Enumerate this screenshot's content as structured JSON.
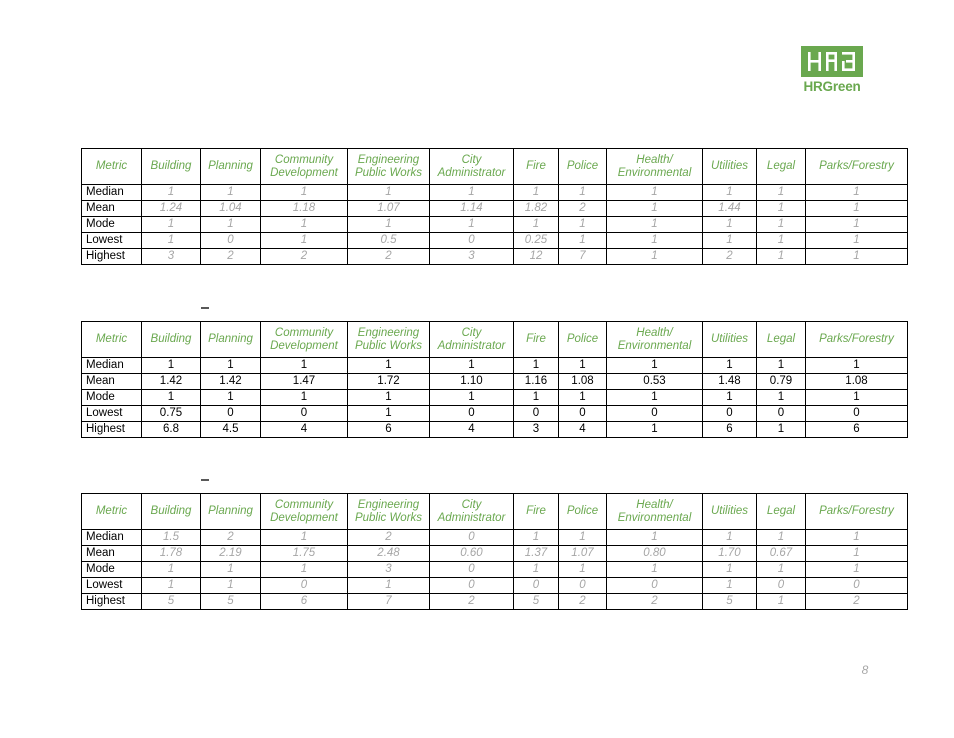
{
  "logo": {
    "mark_text": "HRG",
    "wordmark": "HRGreen",
    "brand_color": "#6aa84f"
  },
  "page": {
    "number": "8",
    "number_color": "#a6a6a6"
  },
  "marks": {
    "dash_1": "-",
    "dash_2": "-"
  },
  "columns": [
    "Metric",
    "Building",
    "Planning",
    "Community Development",
    "Engineering Public Works",
    "City Administrator",
    "Fire",
    "Police",
    "Health/ Environmental",
    "Utilities",
    "Legal",
    "Parks/Forestry"
  ],
  "column_lines": [
    [
      "Metric",
      ""
    ],
    [
      "Building",
      ""
    ],
    [
      "Planning",
      ""
    ],
    [
      "Community",
      "Development"
    ],
    [
      "Engineering",
      "Public Works"
    ],
    [
      "City",
      "Administrator"
    ],
    [
      "Fire",
      ""
    ],
    [
      "Police",
      ""
    ],
    [
      "Health/",
      "Environmental"
    ],
    [
      "Utilities",
      ""
    ],
    [
      "Legal",
      ""
    ],
    [
      "Parks/Forestry",
      ""
    ]
  ],
  "row_labels": [
    "Median",
    "Mean",
    "Mode",
    "Lowest",
    "Highest"
  ],
  "tables": [
    {
      "id": "table1",
      "value_style": "muted",
      "rows": [
        {
          "label": "Median",
          "values": [
            "1",
            "1",
            "1",
            "1",
            "1",
            "1",
            "1",
            "1",
            "1",
            "1",
            "1"
          ]
        },
        {
          "label": "Mean",
          "values": [
            "1.24",
            "1.04",
            "1.18",
            "1.07",
            "1.14",
            "1.82",
            "2",
            "1",
            "1.44",
            "1",
            "1"
          ]
        },
        {
          "label": "Mode",
          "values": [
            "1",
            "1",
            "1",
            "1",
            "1",
            "1",
            "1",
            "1",
            "1",
            "1",
            "1"
          ]
        },
        {
          "label": "Lowest",
          "values": [
            "1",
            "0",
            "1",
            "0.5",
            "0",
            "0.25",
            "1",
            "1",
            "1",
            "1",
            "1"
          ]
        },
        {
          "label": "Highest",
          "values": [
            "3",
            "2",
            "2",
            "2",
            "3",
            "12",
            "7",
            "1",
            "2",
            "1",
            "1"
          ]
        }
      ]
    },
    {
      "id": "table2",
      "value_style": "solid",
      "rows": [
        {
          "label": "Median",
          "values": [
            "1",
            "1",
            "1",
            "1",
            "1",
            "1",
            "1",
            "1",
            "1",
            "1",
            "1"
          ]
        },
        {
          "label": "Mean",
          "values": [
            "1.42",
            "1.42",
            "1.47",
            "1.72",
            "1.10",
            "1.16",
            "1.08",
            "0.53",
            "1.48",
            "0.79",
            "1.08"
          ]
        },
        {
          "label": "Mode",
          "values": [
            "1",
            "1",
            "1",
            "1",
            "1",
            "1",
            "1",
            "1",
            "1",
            "1",
            "1"
          ]
        },
        {
          "label": "Lowest",
          "values": [
            "0.75",
            "0",
            "0",
            "1",
            "0",
            "0",
            "0",
            "0",
            "0",
            "0",
            "0"
          ]
        },
        {
          "label": "Highest",
          "values": [
            "6.8",
            "4.5",
            "4",
            "6",
            "4",
            "3",
            "4",
            "1",
            "6",
            "1",
            "6"
          ]
        }
      ]
    },
    {
      "id": "table3",
      "value_style": "muted",
      "rows": [
        {
          "label": "Median",
          "values": [
            "1.5",
            "2",
            "1",
            "2",
            "0",
            "1",
            "1",
            "1",
            "1",
            "1",
            "1"
          ]
        },
        {
          "label": "Mean",
          "values": [
            "1.78",
            "2.19",
            "1.75",
            "2.48",
            "0.60",
            "1.37",
            "1.07",
            "0.80",
            "1.70",
            "0.67",
            "1"
          ]
        },
        {
          "label": "Mode",
          "values": [
            "1",
            "1",
            "1",
            "3",
            "0",
            "1",
            "1",
            "1",
            "1",
            "1",
            "1"
          ]
        },
        {
          "label": "Lowest",
          "values": [
            "1",
            "1",
            "0",
            "1",
            "0",
            "0",
            "0",
            "0",
            "1",
            "0",
            "0"
          ]
        },
        {
          "label": "Highest",
          "values": [
            "5",
            "5",
            "6",
            "7",
            "2",
            "5",
            "2",
            "2",
            "5",
            "1",
            "2"
          ]
        }
      ]
    }
  ]
}
